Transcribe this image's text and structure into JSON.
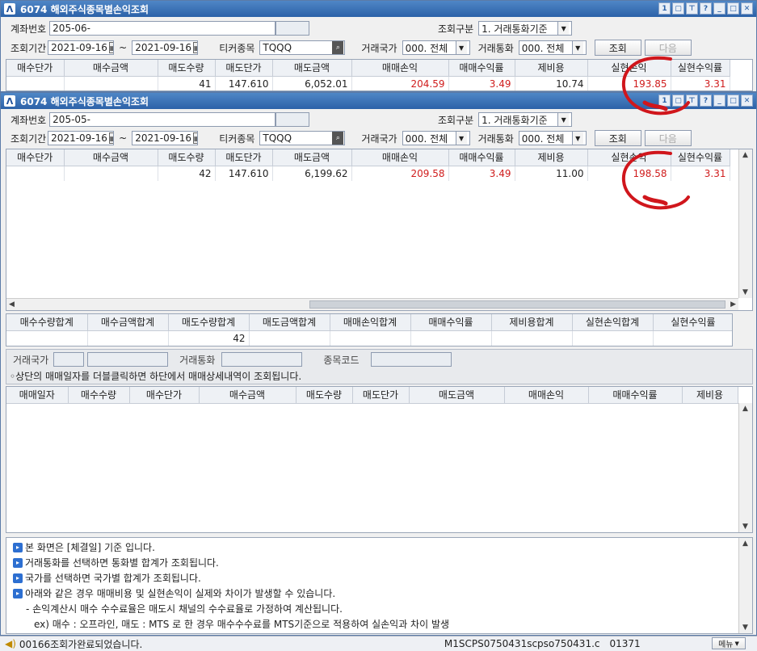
{
  "window1": {
    "title": "6074 해외주식종목별손익조회",
    "account_label": "계좌번호",
    "account_value": "205-06-",
    "query_type_label": "조회구분",
    "query_type_value": "1. 거래통화기준",
    "period_label": "조회기간",
    "date_from": "2021-09-16",
    "date_sep": "~",
    "date_to": "2021-09-16",
    "ticker_label": "티커종목",
    "ticker_value": "TQQQ",
    "country_label": "거래국가",
    "country_value": "000. 전체",
    "currency_label": "거래통화",
    "currency_value": "000. 전체",
    "query_button": "조회",
    "next_button": "다음",
    "headers": [
      "매수단가",
      "매수금액",
      "매도수량",
      "매도단가",
      "매도금액",
      "매매손익",
      "매매수익률",
      "제비용",
      "실현손익",
      "실현수익률"
    ],
    "row": [
      "",
      "",
      "41",
      "147.610",
      "6,052.01",
      "204.59",
      "3.49",
      "10.74",
      "193.85",
      "3.31"
    ]
  },
  "window2": {
    "title": "6074 해외주식종목별손익조회",
    "account_label": "계좌번호",
    "account_value": "205-05-",
    "query_type_label": "조회구분",
    "query_type_value": "1. 거래통화기준",
    "period_label": "조회기간",
    "date_from": "2021-09-16",
    "date_sep": "~",
    "date_to": "2021-09-16",
    "ticker_label": "티커종목",
    "ticker_value": "TQQQ",
    "country_label": "거래국가",
    "country_value": "000. 전체",
    "currency_label": "거래통화",
    "currency_value": "000. 전체",
    "query_button": "조회",
    "next_button": "다음",
    "headers": [
      "매수단가",
      "매수금액",
      "매도수량",
      "매도단가",
      "매도금액",
      "매매손익",
      "매매수익률",
      "제비용",
      "실현손익",
      "실현수익률"
    ],
    "row": [
      "",
      "",
      "42",
      "147.610",
      "6,199.62",
      "209.58",
      "3.49",
      "11.00",
      "198.58",
      "3.31"
    ]
  },
  "totals": {
    "headers": [
      "매수수량합계",
      "매수금액합계",
      "매도수량합계",
      "매도금액합계",
      "매매손익합계",
      "매매수익률",
      "제비용합계",
      "실현손익합계",
      "실현수익률"
    ],
    "values": [
      "",
      "",
      "42",
      "",
      "",
      "",
      "",
      "",
      ""
    ]
  },
  "detail_filter": {
    "country_label": "거래국가",
    "currency_label": "거래통화",
    "code_label": "종목코드",
    "hint": "◦상단의 매매일자를 더블클릭하면 하단에서 매매상세내역이 조회됩니다."
  },
  "detail": {
    "headers": [
      "매매일자",
      "매수수량",
      "매수단가",
      "매수금액",
      "매도수량",
      "매도단가",
      "매도금액",
      "매매손익",
      "매매수익률",
      "제비용"
    ]
  },
  "notes": [
    "본 화면은 [체결일] 기준 입니다.",
    "거래통화를 선택하면 통화별 합계가 조회됩니다.",
    "국가를 선택하면 국가별 합계가 조회됩니다.",
    "아래와 같은 경우 매매비용 및 실현손익이 실제와 차이가 발생할 수 있습니다.",
    "- 손익계산시 매수 수수료율은 매도시 채널의 수수료율로 가정하여 계산됩니다.",
    "ex) 매수 : 오프라인,  매도 : MTS 로 한 경우  매수수수료를 MTS기준으로 적용하여 실손익과 차이 발생"
  ],
  "status": {
    "message": "00166조회가완료되었습니다.",
    "screen_code": "M1SCPS0750431scpso750431.c",
    "number": "01371",
    "menu": "메뉴"
  },
  "colors": {
    "profit": "#d01c1c",
    "title": "#2c62a8",
    "annotation": "#d0161c"
  }
}
